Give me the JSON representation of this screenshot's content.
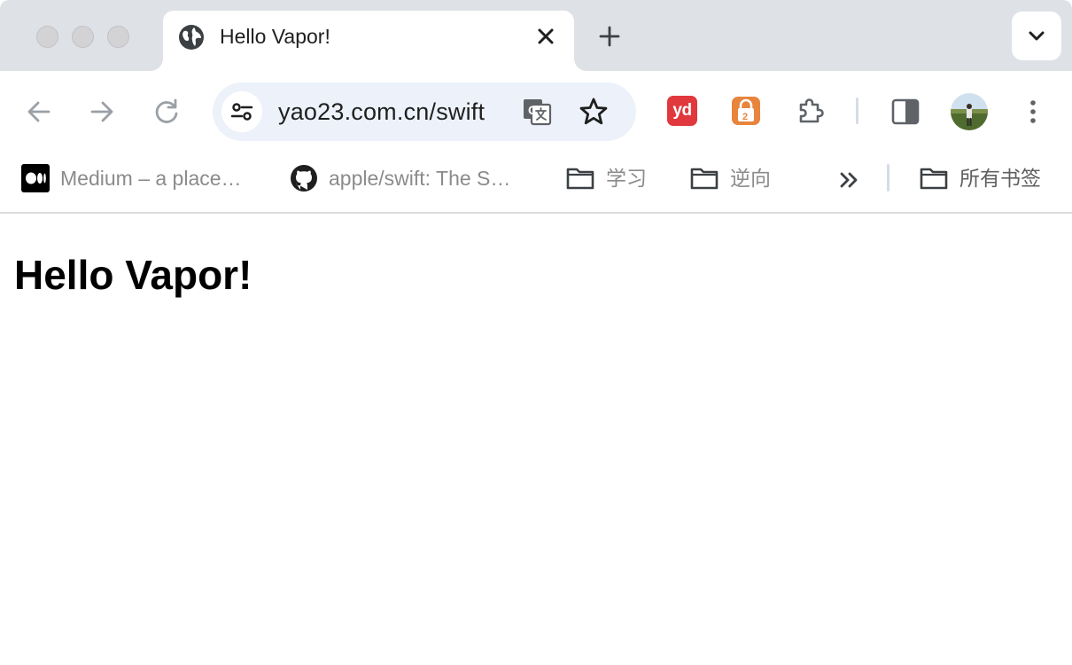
{
  "tab": {
    "title": "Hello Vapor!",
    "favicon": "globe-icon"
  },
  "toolbar": {
    "url": "yao23.com.cn/swift",
    "extensions": [
      {
        "name": "youdao-extension",
        "text": "yd",
        "color": "#e0383d"
      },
      {
        "name": "lock-extension",
        "color": "#e8843c"
      },
      {
        "name": "extensions-puzzle",
        "icon": "puzzle-icon"
      }
    ]
  },
  "bookmarks": {
    "items": [
      {
        "label": "Medium – a place…",
        "icon": "medium-icon"
      },
      {
        "label": "apple/swift: The S…",
        "icon": "github-icon"
      },
      {
        "label": "学习",
        "icon": "folder-icon"
      },
      {
        "label": "逆向",
        "icon": "folder-icon"
      }
    ],
    "all_bookmarks": "所有书签"
  },
  "page": {
    "heading": "Hello Vapor!"
  },
  "colors": {
    "tabstrip": "#dee1e6",
    "omnibox": "#edf2fa",
    "accent_red": "#e0383d",
    "accent_orange": "#e8843c"
  }
}
